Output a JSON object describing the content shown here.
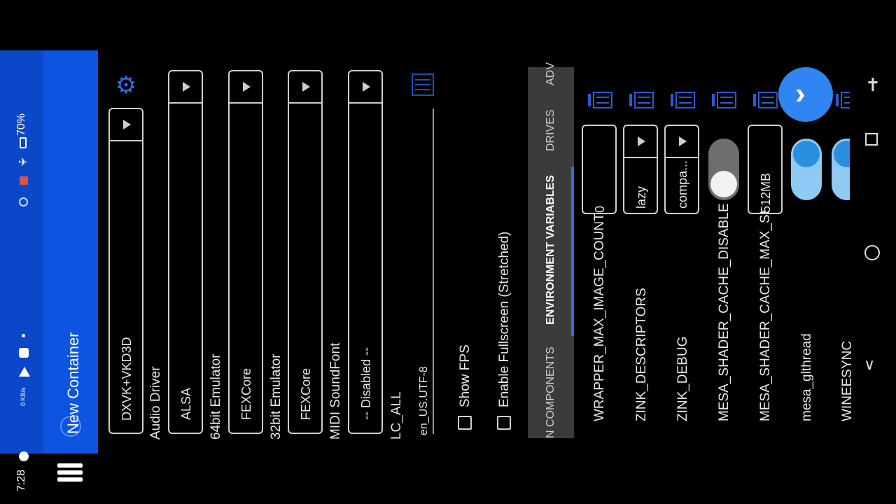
{
  "status": {
    "time": "7:28",
    "battery": "70%",
    "data_speed_top": "0",
    "data_speed_unit": "KB/s"
  },
  "appbar": {
    "title": "New Container",
    "menu_icon": "menu-icon"
  },
  "form": {
    "graphics_driver_value": "DXVK+VKD3D",
    "audio_driver_label": "Audio Driver",
    "audio_driver_value": "ALSA",
    "emulator64_label": "64bit Emulator",
    "emulator64_value": "FEXCore",
    "emulator32_label": "32bit Emulator",
    "emulator32_value": "FEXCore",
    "midi_label": "MIDI SoundFont",
    "midi_value": "-- Disabled --",
    "lc_all_label": "LC_ALL",
    "lc_all_value": "en_US.UTF-8",
    "show_fps_label": "Show FPS",
    "fullscreen_label": "Enable Fullscreen (Stretched)"
  },
  "tabs": [
    {
      "label": "N COMPONENTS"
    },
    {
      "label": "ENVIRONMENT VARIABLES"
    },
    {
      "label": "DRIVES"
    },
    {
      "label": "ADV"
    }
  ],
  "env_vars": [
    {
      "name": "WRAPPER_MAX_IMAGE_COUNT",
      "value": "0"
    },
    {
      "name": "ZINK_DESCRIPTORS",
      "value": "lazy"
    },
    {
      "name": "ZINK_DEBUG",
      "value": "compa..."
    },
    {
      "name": "MESA_SHADER_CACHE_DISABLE",
      "value": ""
    },
    {
      "name": "MESA_SHADER_CACHE_MAX_SI",
      "value": "512MB"
    },
    {
      "name": "mesa_glthread",
      "value": ""
    },
    {
      "name": "WINEESYNC",
      "value": ""
    }
  ],
  "colors": {
    "accent": "#2f6fe0",
    "statusbar": "#0a47c9",
    "appbar": "#0d55e0",
    "tabbar": "#3b3b3b",
    "toggle_on": "#2b8fe0",
    "fab": "#2f86f0"
  }
}
